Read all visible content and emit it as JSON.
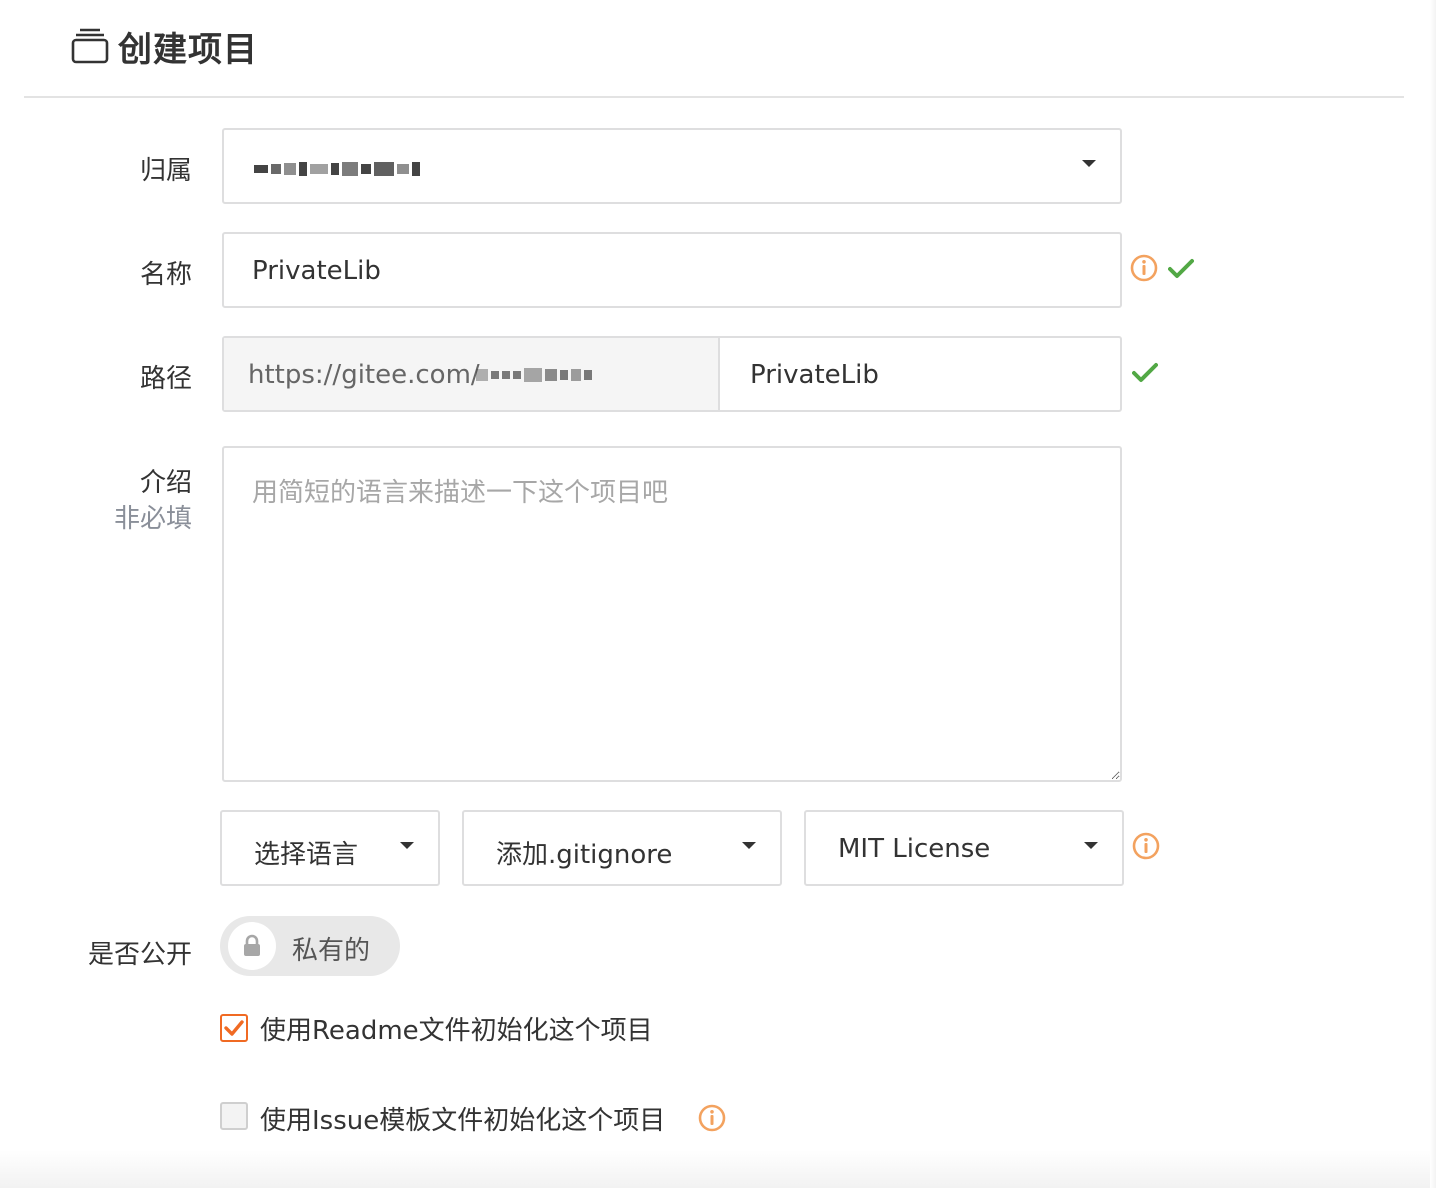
{
  "page": {
    "title": "创建项目"
  },
  "form": {
    "owner": {
      "label": "归属"
    },
    "name": {
      "label": "名称",
      "value": "PrivateLib"
    },
    "path": {
      "label": "路径",
      "prefix": "https://gitee.com/",
      "value": "PrivateLib"
    },
    "description": {
      "label": "介绍",
      "sub_label": "非必填",
      "placeholder": "用简短的语言来描述一下这个项目吧"
    },
    "language": {
      "selected": "选择语言"
    },
    "gitignore": {
      "selected": "添加.gitignore"
    },
    "license": {
      "selected": "MIT License"
    },
    "visibility": {
      "label": "是否公开",
      "value": "私有的"
    },
    "readme": {
      "label": "使用Readme文件初始化这个项目",
      "checked": true
    },
    "issue_template": {
      "label": "使用Issue模板文件初始化这个项目",
      "checked": false
    }
  },
  "colors": {
    "accent": "#f06a23",
    "success": "#52a845",
    "info": "#f3a25f",
    "border": "#dededf"
  },
  "icons": {
    "header": "project-box-icon",
    "owner_caret": "chevron-down-icon",
    "info": "info-circle-icon",
    "valid": "check-icon",
    "lock": "lock-icon"
  }
}
